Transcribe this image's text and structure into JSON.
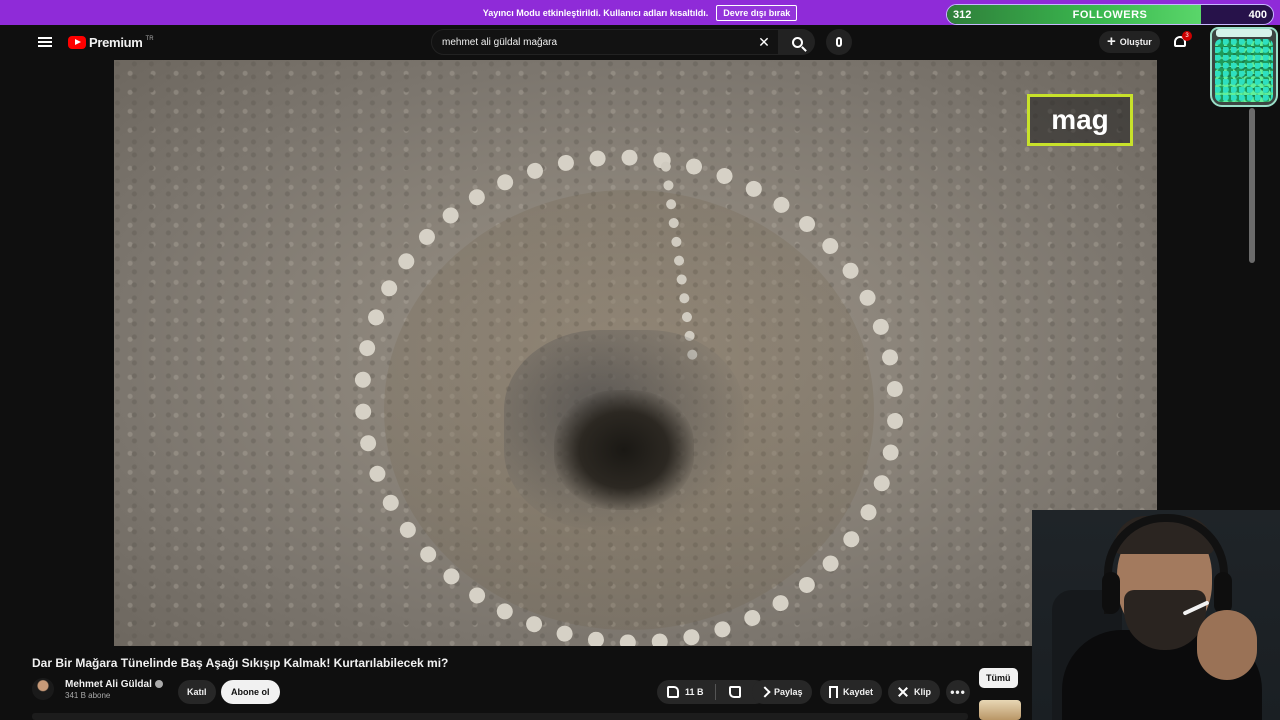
{
  "banner": {
    "text": "Yayıncı Modu etkinleştirildi. Kullanıcı adları kısaltıldı.",
    "button": "Devre dışı bırak"
  },
  "followers_goal": {
    "current": "312",
    "label": "FOLLOWERS",
    "goal": "400",
    "progress_fraction": 0.78,
    "fill_color": "#3ab84f"
  },
  "header": {
    "logo_text": "Premium",
    "logo_region": "TR",
    "search_value": "mehmet ali güldal mağara",
    "create_label": "Oluştur",
    "notifications_count": "3"
  },
  "video": {
    "overlay_text": "mag",
    "overlay_border_color": "#c8e22a"
  },
  "details": {
    "title": "Dar Bir Mağara Tünelinde Baş Aşağı Sıkışıp Kalmak! Kurtarılabilecek mi?",
    "channel_name": "Mehmet Ali Güldal",
    "subscribers": "341 B abone",
    "join_label": "Katıl",
    "subscribe_label": "Abone ol",
    "likes": "11 B",
    "share_label": "Paylaş",
    "save_label": "Kaydet",
    "clip_label": "Klip",
    "more_label": "•••"
  },
  "sidebar_chips": {
    "all_label": "Tümü"
  },
  "colors": {
    "banner": "#8f2bd8",
    "youtube_red": "#ff0000",
    "background": "#0f0f0f"
  }
}
